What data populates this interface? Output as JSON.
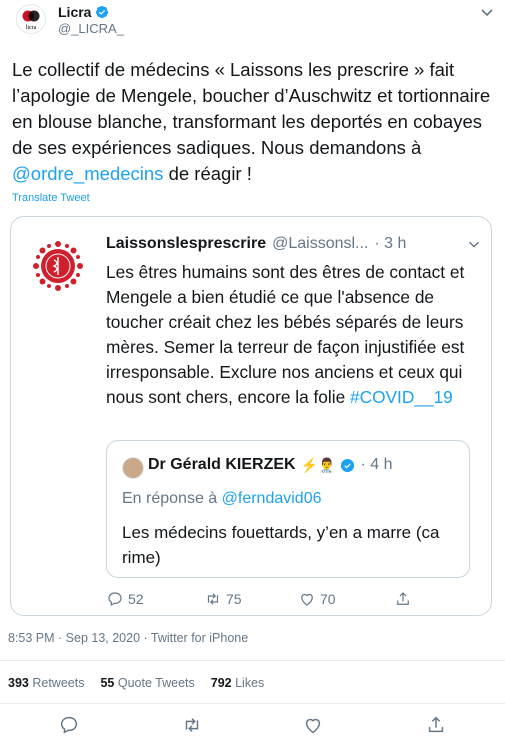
{
  "author": {
    "name": "Licra",
    "handle": "@_LICRA_",
    "logo_text": "licra"
  },
  "tweet": {
    "text_before": "Le collectif de médecins « Laissons les prescrire » fait l’apologie de Mengele, boucher d’Auschwitz et tortionnaire en blouse blanche, transformant les deportés en cobayes de ses expériences sadiques. Nous demandons à ",
    "mention": "@ordre_medecins",
    "text_after": " de réagir !",
    "translate_label": "Translate Tweet"
  },
  "quoted": {
    "name": "Laissonslesprescrire",
    "handle": "@Laissonsl...",
    "time": "· 3 h",
    "text": "Les êtres humains sont des êtres de contact et Mengele a bien étudié ce que l'absence de toucher créait chez les bébés séparés de leurs mères. Semer la terreur de façon injustifiée est irresponsable. Exclure nos anciens et ceux qui nous sont chers, encore la folie ",
    "hashtag": "#COVID__19",
    "inner": {
      "name": "Dr Gérald KIERZEK",
      "emoji": "⚡️👨‍⚕️",
      "time": "· 4 h",
      "reply_prefix": "En réponse à ",
      "reply_mention": "@ferndavid06",
      "text": "Les médecins fouettards, y’en a marre (ca rime)"
    },
    "actions": {
      "replies": "52",
      "retweets": "75",
      "likes": "70"
    }
  },
  "meta": {
    "timestamp": "8:53 PM · Sep 13, 2020 · Twitter for iPhone"
  },
  "stats": {
    "retweets_count": "393",
    "retweets_label": "Retweets",
    "quotes_count": "55",
    "quotes_label": "Quote Tweets",
    "likes_count": "792",
    "likes_label": "Likes"
  },
  "colors": {
    "accent": "#1da1f2",
    "muted": "#657786",
    "logo_red": "#c8102e"
  }
}
